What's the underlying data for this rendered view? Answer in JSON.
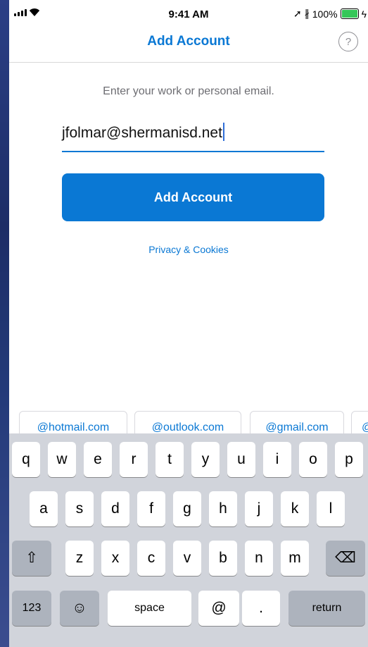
{
  "status": {
    "time": "9:41 AM",
    "battery": "100%",
    "battery_level": 1.0,
    "icons": [
      "cellular-signal-icon",
      "wifi-icon",
      "location-arrow-icon",
      "bluetooth-icon",
      "battery-icon",
      "charging-bolt-icon"
    ]
  },
  "header": {
    "title": "Add Account",
    "help": "?"
  },
  "form": {
    "prompt": "Enter your work or personal email.",
    "email_value": "jfolmar@shermanisd.net",
    "add_button": "Add Account",
    "privacy_link": "Privacy & Cookies"
  },
  "suggestions": [
    "@hotmail.com",
    "@outlook.com",
    "@gmail.com",
    "@"
  ],
  "keyboard": {
    "row1": [
      "q",
      "w",
      "e",
      "r",
      "t",
      "y",
      "u",
      "i",
      "o",
      "p"
    ],
    "row2": [
      "a",
      "s",
      "d",
      "f",
      "g",
      "h",
      "j",
      "k",
      "l"
    ],
    "row3": [
      "z",
      "x",
      "c",
      "v",
      "b",
      "n",
      "m"
    ],
    "shift": "⇧",
    "delete": "⌫",
    "numbers": "123",
    "emoji": "☺",
    "space": "space",
    "at": "@",
    "period": ".",
    "return": "return"
  },
  "colors": {
    "accent": "#0a78d4",
    "keyboard_bg": "#d1d4db",
    "battery": "#35c759"
  }
}
